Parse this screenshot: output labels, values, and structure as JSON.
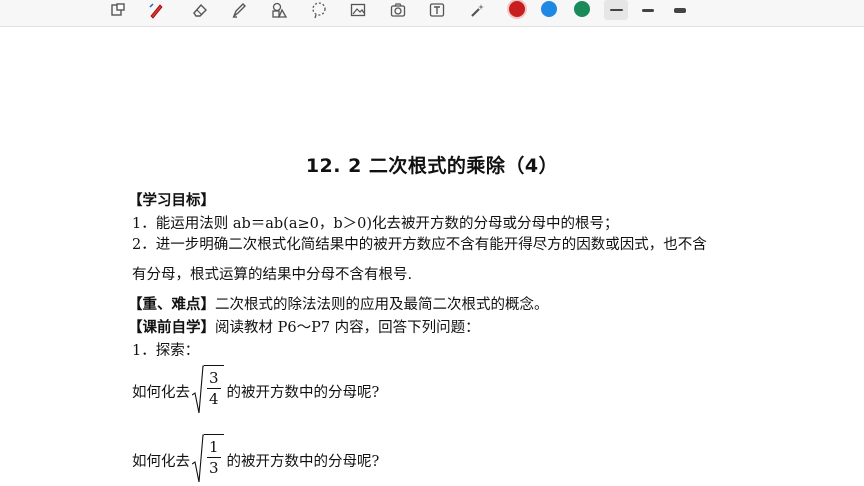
{
  "toolbar": {
    "tools": [
      "window-icon",
      "pen-icon",
      "eraser-icon",
      "highlighter-icon",
      "shapes-icon",
      "lasso-icon",
      "image-icon",
      "camera-icon",
      "textbox-icon",
      "laser-pointer-icon"
    ],
    "colors": [
      "#c81e1e",
      "#1e88e5",
      "#1b8a5a"
    ]
  },
  "document": {
    "title": "12. 2 二次根式的乘除（4）",
    "goals_heading": "【学习目标】",
    "goal_1": "1．能运用法则 ab＝ab(a≥0，b＞0)化去被开方数的分母或分母中的根号；",
    "goal_2a": "2．进一步明确二次根式化简结果中的被开方数应不含有能开得尽方的因数或因式，也不含",
    "goal_2b": "有分母，根式运算的结果中分母不含有根号.",
    "focus_label": "【重、难点】",
    "focus_text": "二次根式的除法法则的应用及最简二次根式的概念。",
    "preclass_label": "【课前自学】",
    "preclass_text": "阅读教材 P6～P7 内容，回答下列问题：",
    "explore": "1．探索：",
    "q1_prefix": "如何化去",
    "q1_num": "3",
    "q1_den": "4",
    "q1_suffix": "的被开方数中的分母呢?",
    "q2_prefix": "如何化去",
    "q2_num": "1",
    "q2_den": "3",
    "q2_suffix": "的被开方数中的分母呢?"
  }
}
